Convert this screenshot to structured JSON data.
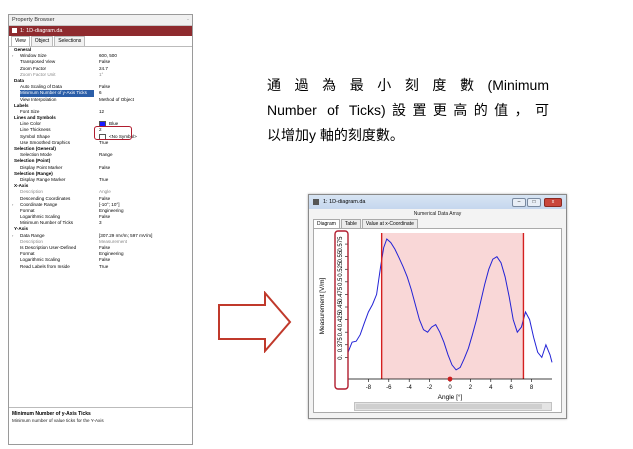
{
  "property_browser": {
    "title": "Property Browser",
    "pin": "·",
    "document": "1: 1D-diagram.da",
    "tabs": [
      "View",
      "Object",
      "Selections"
    ],
    "rows": [
      {
        "kind": "cat",
        "name": "General",
        "value": ""
      },
      {
        "kind": "prop",
        "name": "Window Size",
        "value": "600, 500",
        "exp": "›"
      },
      {
        "kind": "prop",
        "name": "Transposed View",
        "value": "False"
      },
      {
        "kind": "prop",
        "name": "Zoom Factor",
        "value": "24.7"
      },
      {
        "kind": "dis",
        "name": "Zoom Factor Unit",
        "value": "1°"
      },
      {
        "kind": "cat",
        "name": "Data",
        "value": ""
      },
      {
        "kind": "prop",
        "name": "Auto Scaling of Data",
        "value": "False"
      },
      {
        "kind": "sel",
        "name": "Minimum Number of y-Axis Ticks",
        "value": "6"
      },
      {
        "kind": "prop",
        "name": "View Interpolation",
        "value": "Method of Object"
      },
      {
        "kind": "cat",
        "name": "Labels",
        "value": ""
      },
      {
        "kind": "prop",
        "name": "Font Size",
        "value": "12"
      },
      {
        "kind": "cat",
        "name": "Lines and Symbols",
        "value": ""
      },
      {
        "kind": "prop",
        "name": "Line Color",
        "value": "Blue",
        "swatch": "#1a1aff"
      },
      {
        "kind": "prop",
        "name": "Line Thickness",
        "value": "2"
      },
      {
        "kind": "prop",
        "name": "Symbol Shape",
        "value": "<No Symbol>",
        "swatch": "#ffffff"
      },
      {
        "kind": "prop",
        "name": "Use Smoothed Graphics",
        "value": "True"
      },
      {
        "kind": "cat",
        "name": "Selection (General)",
        "value": ""
      },
      {
        "kind": "prop",
        "name": "Selection Mode",
        "value": "Range"
      },
      {
        "kind": "cat",
        "name": "Selection (Point)",
        "value": ""
      },
      {
        "kind": "prop",
        "name": "Display Point Marker",
        "value": "False"
      },
      {
        "kind": "cat",
        "name": "Selection (Range)",
        "value": ""
      },
      {
        "kind": "prop",
        "name": "Display Range Marker",
        "value": "True"
      },
      {
        "kind": "cat",
        "name": "X-Axis",
        "value": ""
      },
      {
        "kind": "dis",
        "name": "Description",
        "value": "Angle"
      },
      {
        "kind": "prop",
        "name": "Descending Coordinates",
        "value": "False"
      },
      {
        "kind": "prop",
        "name": "Coordinate Range",
        "value": "[-10°; 10°]",
        "exp": "›"
      },
      {
        "kind": "prop",
        "name": "Format",
        "value": "Engineering"
      },
      {
        "kind": "prop",
        "name": "Logarithmic Scaling",
        "value": "False"
      },
      {
        "kind": "prop",
        "name": "Minimum Number of Ticks",
        "value": "3"
      },
      {
        "kind": "cat",
        "name": "Y-Axis",
        "value": ""
      },
      {
        "kind": "prop",
        "name": "Data Range",
        "value": "[307.29 mV/m; 597 mV/m]",
        "exp": "›"
      },
      {
        "kind": "dis",
        "name": "Description",
        "value": "Measurement"
      },
      {
        "kind": "prop",
        "name": "Is Description User-Defined",
        "value": "False"
      },
      {
        "kind": "prop",
        "name": "Format",
        "value": "Engineering"
      },
      {
        "kind": "prop",
        "name": "Logarithmic Scaling",
        "value": "False"
      },
      {
        "kind": "prop",
        "name": "Read Labels from Inside",
        "value": "True"
      }
    ],
    "help_title": "Minimum Number of y-Axis Ticks",
    "help_text": "Minimum number of value ticks for the Y-Axis"
  },
  "caption": {
    "line1": "通過為最小刻度數(Minimum",
    "line2": "Number of Ticks)設置更高的值，可",
    "line3": "以增加y 軸的刻度數。"
  },
  "chart_window": {
    "title": "1: 1D-diagram.da",
    "subtitle": "Numerical Data Array",
    "btn_min": "–",
    "btn_max": "□",
    "btn_close": "x",
    "tabs": [
      "Diagram",
      "Table",
      "Value at x-Coordinate"
    ]
  },
  "chart_data": {
    "type": "line",
    "xlabel": "Angle [°]",
    "ylabel": "Measurement [V/m]",
    "xlim": [
      -10,
      10
    ],
    "ylim": [
      0.307,
      0.597
    ],
    "x_ticks": [
      "-8",
      "-6",
      "-4",
      "-2",
      "0",
      "2",
      "4",
      "6",
      "8"
    ],
    "x_tick_values": [
      -8,
      -6,
      -4,
      -2,
      0,
      2,
      4,
      6,
      8
    ],
    "y_ticks": [
      "0.",
      "0.375",
      "0.4",
      "0.425",
      "0.45",
      "0.475",
      "0.5",
      "0.525",
      "0.55",
      "0.575"
    ],
    "y_tick_values": [
      0.35,
      0.375,
      0.4,
      0.425,
      0.45,
      0.475,
      0.5,
      0.525,
      0.55,
      0.575
    ],
    "selection_range": [
      -6.7,
      7.2
    ],
    "point_marker_x": 0,
    "line_color": "#2323d6",
    "range_fill": "#f9d7d7",
    "range_line": "#d41f1f",
    "series": [
      {
        "x": [
          -10,
          -9.6,
          -9.2,
          -8.8,
          -8.4,
          -8,
          -7.6,
          -7.2,
          -6.8,
          -6.5,
          -6.2,
          -5.8,
          -5.4,
          -5,
          -4.6,
          -4.2,
          -3.8,
          -3.4,
          -3,
          -2.6,
          -2.2,
          -1.8,
          -1.4,
          -1,
          -0.6,
          -0.2,
          0.2,
          0.6,
          1,
          1.4,
          1.8,
          2.2,
          2.6,
          3,
          3.4,
          3.8,
          4.2,
          4.6,
          5,
          5.4,
          5.8,
          6.2,
          6.6,
          7,
          7.4,
          7.8,
          8.2,
          8.6,
          9,
          9.4,
          9.8,
          10
        ],
        "y": [
          0.36,
          0.38,
          0.382,
          0.395,
          0.418,
          0.44,
          0.455,
          0.475,
          0.53,
          0.568,
          0.585,
          0.578,
          0.565,
          0.548,
          0.53,
          0.51,
          0.485,
          0.455,
          0.425,
          0.405,
          0.4,
          0.41,
          0.415,
          0.4,
          0.38,
          0.355,
          0.335,
          0.325,
          0.33,
          0.348,
          0.368,
          0.395,
          0.425,
          0.46,
          0.495,
          0.525,
          0.545,
          0.55,
          0.538,
          0.51,
          0.47,
          0.425,
          0.4,
          0.41,
          0.44,
          0.425,
          0.39,
          0.36,
          0.35,
          0.375,
          0.355,
          0.34
        ]
      }
    ]
  }
}
